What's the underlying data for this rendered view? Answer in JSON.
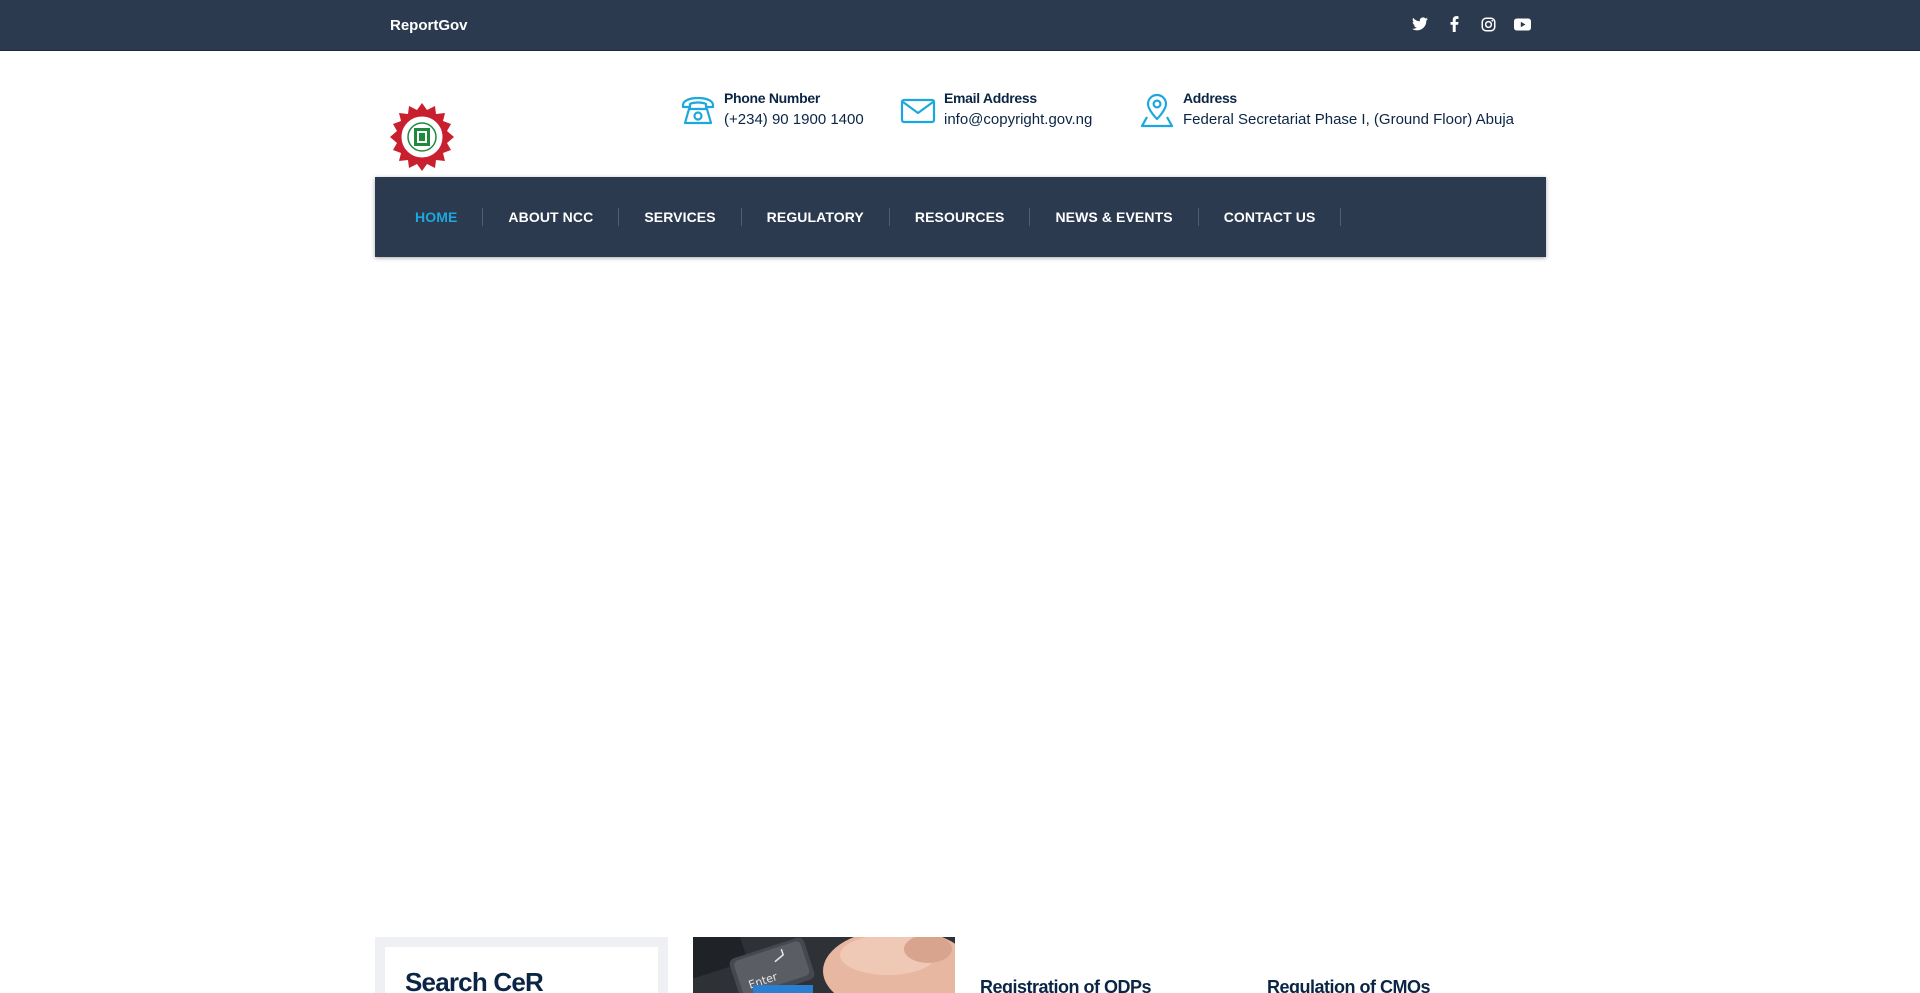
{
  "topbar": {
    "brand": "ReportGov",
    "socials": [
      {
        "icon": "twitter-icon"
      },
      {
        "icon": "facebook-icon"
      },
      {
        "icon": "instagram-icon"
      },
      {
        "icon": "youtube-icon"
      }
    ]
  },
  "header": {
    "contacts": [
      {
        "icon": "phone-icon",
        "title": "Phone Number",
        "value": "(+234) 90 1900 1400"
      },
      {
        "icon": "email-icon",
        "title": "Email Address",
        "value": "info@copyright.gov.ng"
      },
      {
        "icon": "location-pin-icon",
        "title": "Address",
        "value": "Federal Secretariat Phase I, (Ground Floor) Abuja"
      }
    ]
  },
  "nav": {
    "items": [
      {
        "label": "HOME",
        "active": true
      },
      {
        "label": "ABOUT NCC"
      },
      {
        "label": "SERVICES"
      },
      {
        "label": "REGULATORY"
      },
      {
        "label": "RESOURCES"
      },
      {
        "label": "NEWS & EVENTS"
      },
      {
        "label": "CONTACT US"
      }
    ]
  },
  "content": {
    "search_title": "Search CeR",
    "services": [
      {
        "title": "Registration of ODPs"
      },
      {
        "title": "Regulation of CMOs"
      }
    ]
  },
  "colors": {
    "navy": "#2c3a4f",
    "accent": "#1ca8dd",
    "text": "#0b2545"
  }
}
